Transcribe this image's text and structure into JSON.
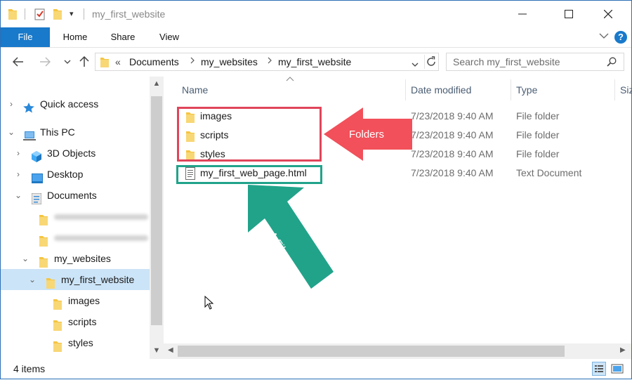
{
  "window": {
    "title": "my_first_website",
    "controls": [
      "minimize-icon",
      "maximize-icon",
      "close-icon"
    ]
  },
  "ribbon": {
    "tabs": [
      "File",
      "Home",
      "Share",
      "View"
    ],
    "help_label": "?"
  },
  "address": {
    "overflow": "«",
    "crumbs": [
      "Documents",
      "my_websites",
      "my_first_website"
    ],
    "search_placeholder": "Search my_first_website"
  },
  "nav": {
    "quick_access": "Quick access",
    "this_pc": "This PC",
    "objects_3d": "3D Objects",
    "desktop": "Desktop",
    "documents": "Documents",
    "my_websites": "my_websites",
    "my_first_website": "my_first_website",
    "images": "images",
    "scripts": "scripts",
    "styles": "styles"
  },
  "columns": {
    "name": "Name",
    "date_modified": "Date modified",
    "type": "Type",
    "size": "Siz"
  },
  "files": [
    {
      "name": "images",
      "date": "7/23/2018 9:40 AM",
      "type": "File folder",
      "icon": "folder-icon"
    },
    {
      "name": "scripts",
      "date": "7/23/2018 9:40 AM",
      "type": "File folder",
      "icon": "folder-icon"
    },
    {
      "name": "styles",
      "date": "7/23/2018 9:40 AM",
      "type": "File folder",
      "icon": "folder-icon"
    },
    {
      "name": "my_first_web_page.html",
      "date": "7/23/2018 9:40 AM",
      "type": "Text Document",
      "icon": "document-icon"
    }
  ],
  "annotations": {
    "folders_label": "Folders",
    "file_label": "A File",
    "folders_color": "#f2505a",
    "file_color": "#21a38a"
  },
  "status": {
    "count": "4 items"
  },
  "colors": {
    "accent": "#1979ca",
    "selection": "#cce4f7",
    "folder": "#f5c542"
  }
}
